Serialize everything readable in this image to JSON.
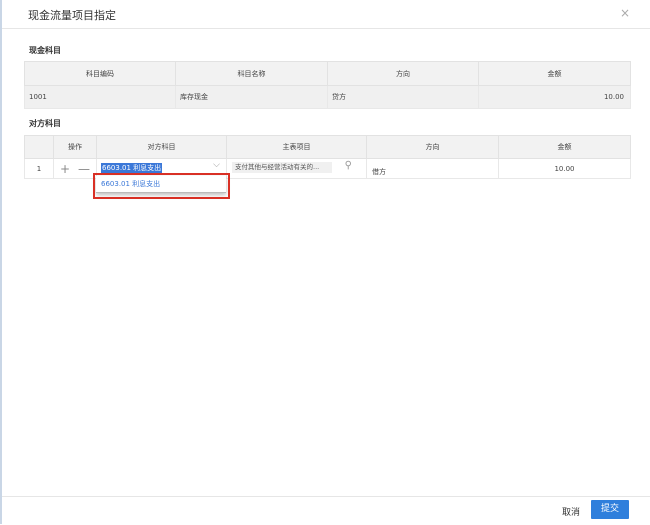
{
  "dialog": {
    "title": "现金流量项目指定",
    "close_symbol": "×"
  },
  "cash_section": {
    "label": "现金科目",
    "columns": [
      "科目编码",
      "科目名称",
      "方向",
      "金额"
    ],
    "row": {
      "code": "1001",
      "name": "库存现金",
      "direction": "贷方",
      "amount": "10.00"
    }
  },
  "counter_section": {
    "label": "对方科目",
    "columns": [
      "",
      "操作",
      "对方科目",
      "主表项目",
      "方向",
      "金额"
    ],
    "row": {
      "index": "1",
      "add_symbol": "+",
      "remove_symbol": "—",
      "account": "6603.01 利息支出",
      "main_item": "支付其他与经营活动有关的...",
      "direction": "借方",
      "amount": "10.00"
    }
  },
  "dropdown": {
    "options": [
      "6603.01 利息支出"
    ]
  },
  "footer": {
    "cancel_label": "取消",
    "submit_label": "提交"
  },
  "colors": {
    "accent": "#2f7fdc",
    "selection": "#3b78d8",
    "highlight_border": "#d93025"
  }
}
